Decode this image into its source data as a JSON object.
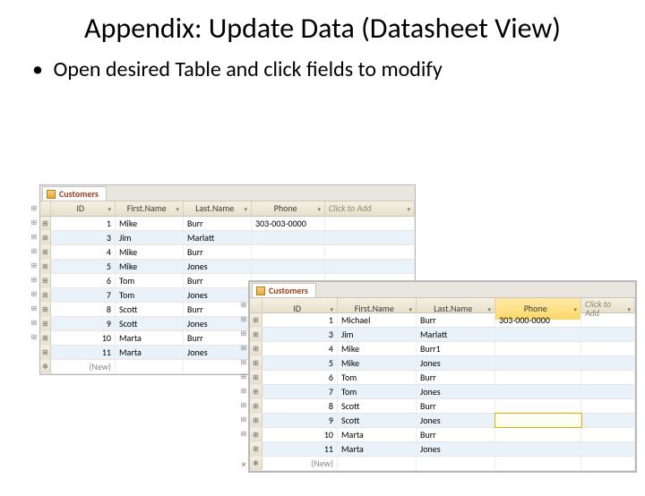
{
  "title": "Appendix: Update Data (Datasheet View)",
  "bullet": "Open desired Table and click fields to modify",
  "tab_label": "Customers",
  "headers": {
    "id": "ID",
    "first": "First.Name",
    "last": "Last.Name",
    "phone": "Phone",
    "add": "Click to Add"
  },
  "new_label": "(New)",
  "rowsA": [
    {
      "id": "1",
      "first": "Mike",
      "last": "Burr",
      "phone": "303-003-0000"
    },
    {
      "id": "3",
      "first": "Jim",
      "last": "Marlatt",
      "phone": ""
    },
    {
      "id": "4",
      "first": "Mike",
      "last": "Burr",
      "phone": ""
    },
    {
      "id": "5",
      "first": "Mike",
      "last": "Jones",
      "phone": ""
    },
    {
      "id": "6",
      "first": "Tom",
      "last": "Burr",
      "phone": ""
    },
    {
      "id": "7",
      "first": "Tom",
      "last": "Jones",
      "phone": ""
    },
    {
      "id": "8",
      "first": "Scott",
      "last": "Burr",
      "phone": ""
    },
    {
      "id": "9",
      "first": "Scott",
      "last": "Jones",
      "phone": ""
    },
    {
      "id": "10",
      "first": "Marta",
      "last": "Burr",
      "phone": ""
    },
    {
      "id": "11",
      "first": "Marta",
      "last": "Jones",
      "phone": ""
    }
  ],
  "rowsB": [
    {
      "id": "1",
      "first": "Michael",
      "last": "Burr",
      "phone": "303-000-0000"
    },
    {
      "id": "3",
      "first": "Jim",
      "last": "Marlatt",
      "phone": ""
    },
    {
      "id": "4",
      "first": "Mike",
      "last": "Burr1",
      "phone": ""
    },
    {
      "id": "5",
      "first": "Mike",
      "last": "Jones",
      "phone": ""
    },
    {
      "id": "6",
      "first": "Tom",
      "last": "Burr",
      "phone": ""
    },
    {
      "id": "7",
      "first": "Tom",
      "last": "Jones",
      "phone": ""
    },
    {
      "id": "8",
      "first": "Scott",
      "last": "Burr",
      "phone": ""
    },
    {
      "id": "9",
      "first": "Scott",
      "last": "Jones",
      "phone": "",
      "editing": true
    },
    {
      "id": "10",
      "first": "Marta",
      "last": "Burr",
      "phone": ""
    },
    {
      "id": "11",
      "first": "Marta",
      "last": "Jones",
      "phone": ""
    }
  ],
  "highlight_phone_b": true
}
